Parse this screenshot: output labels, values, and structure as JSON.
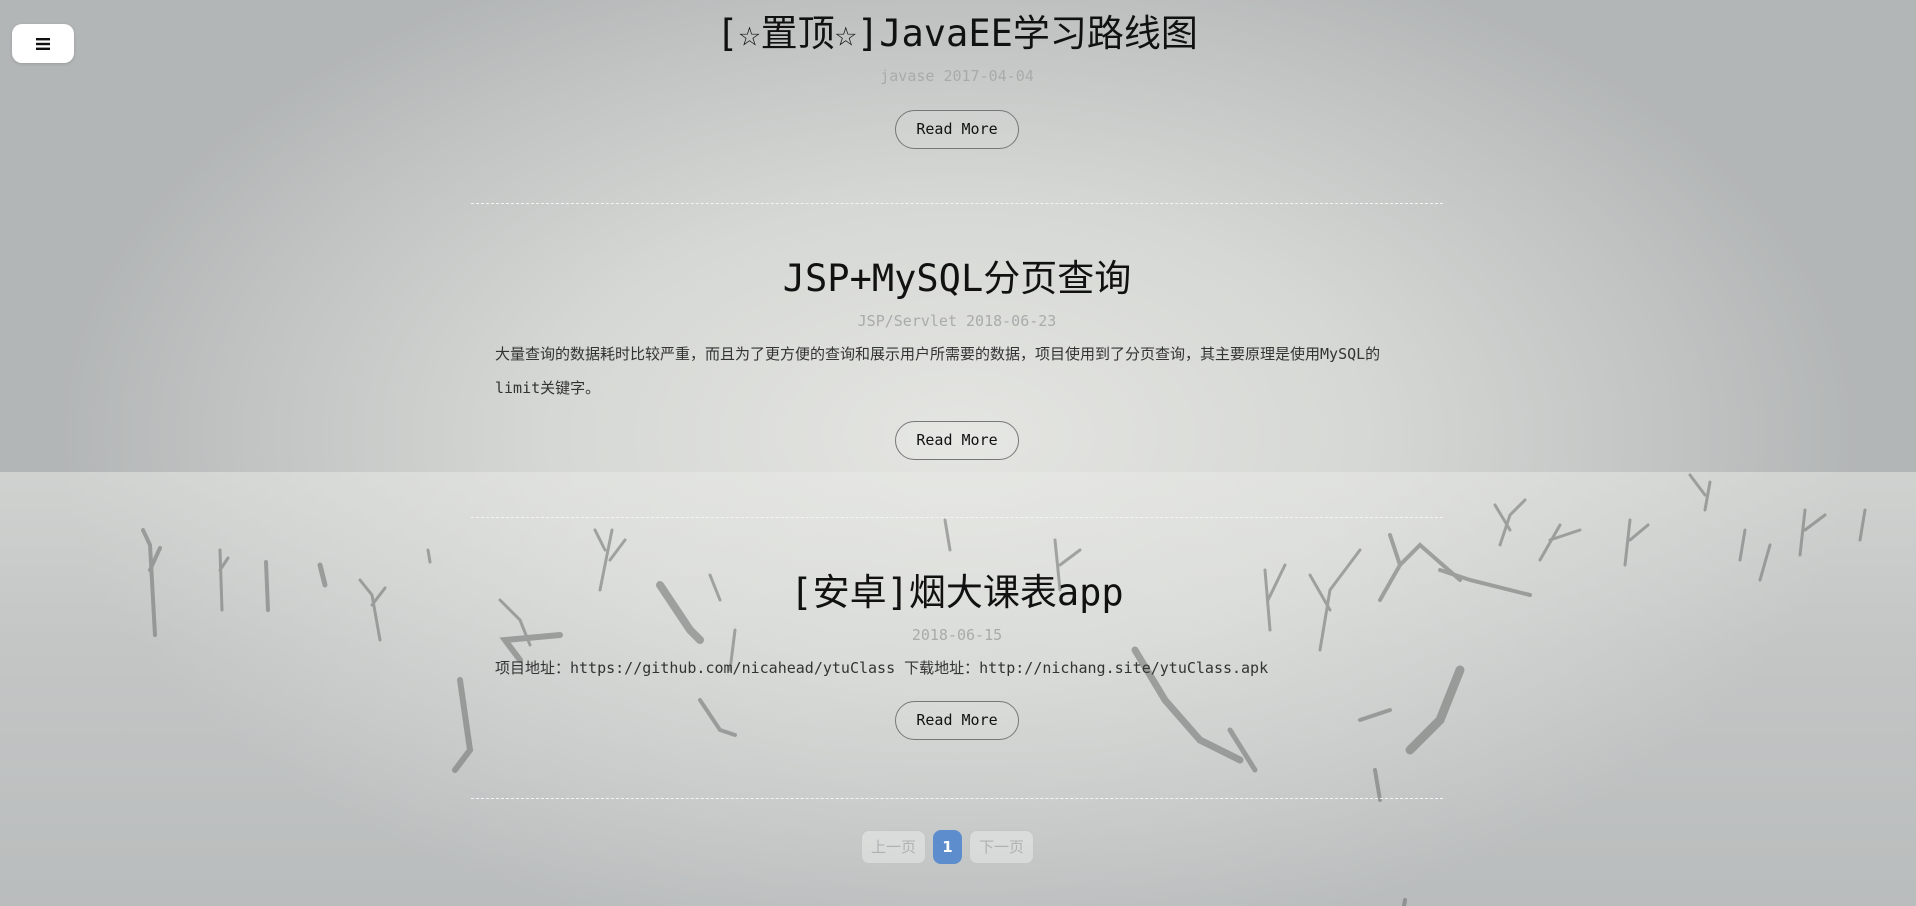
{
  "nav": {
    "menu_icon": "hamburger-menu-icon"
  },
  "posts": [
    {
      "title": "[☆置顶☆]JavaEE学习路线图",
      "meta": "javase 2017-04-04",
      "excerpt": "",
      "read_more": "Read More"
    },
    {
      "title": "JSP+MySQL分页查询",
      "meta": "JSP/Servlet 2018-06-23",
      "excerpt": "大量查询的数据耗时比较严重，而且为了更方便的查询和展示用户所需要的数据，项目使用到了分页查询，其主要原理是使用MySQL的limit关键字。",
      "read_more": "Read More"
    },
    {
      "title": "[安卓]烟大课表app",
      "meta": "2018-06-15",
      "excerpt": "项目地址：https://github.com/nicahead/ytuClass 下载地址：http://nichang.site/ytuClass.apk",
      "read_more": "Read More"
    }
  ],
  "pagination": {
    "prev": "上一页",
    "current": "1",
    "next": "下一页"
  },
  "colors": {
    "active_page": "#5e8dcd"
  }
}
